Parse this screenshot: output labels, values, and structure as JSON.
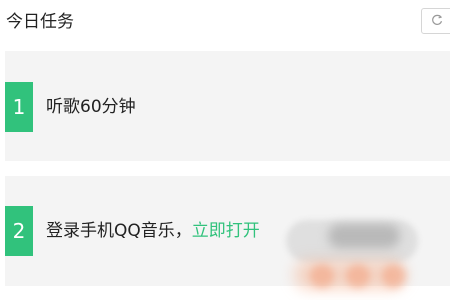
{
  "header": {
    "title": "今日任务",
    "refresh_icon": "refresh-icon"
  },
  "tasks": [
    {
      "number": "1",
      "text": "听歌60分钟"
    },
    {
      "number": "2",
      "text": "登录手机QQ音乐，",
      "link": "立即打开"
    }
  ],
  "colors": {
    "accent": "#31c27c",
    "card_bg": "#f4f4f4",
    "text": "#222222",
    "border": "#d6d6d6"
  }
}
